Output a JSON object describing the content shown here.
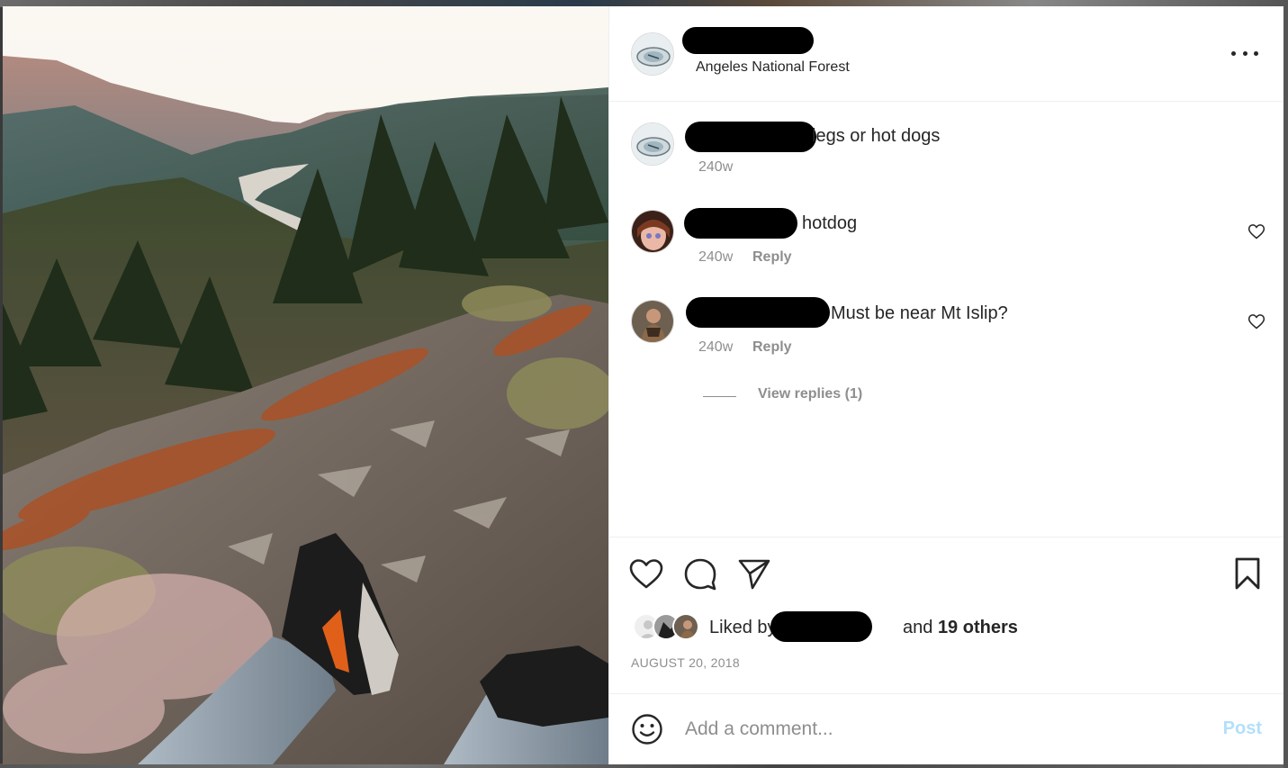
{
  "post": {
    "location": "Angeles National Forest",
    "more_icon": "more-horizontal-icon"
  },
  "comments": [
    {
      "text": "legs or hot dogs",
      "time": "240w"
    },
    {
      "text": "hotdog",
      "time": "240w",
      "reply_label": "Reply"
    },
    {
      "text": "Must be near Mt Islip?",
      "time": "240w",
      "reply_label": "Reply",
      "view_replies": "View replies (1)"
    }
  ],
  "likes": {
    "prefix": "Liked by",
    "joiner": "and",
    "others": "19 others"
  },
  "date": "AUGUST 20, 2018",
  "composer": {
    "placeholder": "Add a comment...",
    "post_label": "Post"
  },
  "colors": {
    "post_button": "#b2dffc",
    "muted": "#8e8e8e",
    "text": "#262626"
  }
}
